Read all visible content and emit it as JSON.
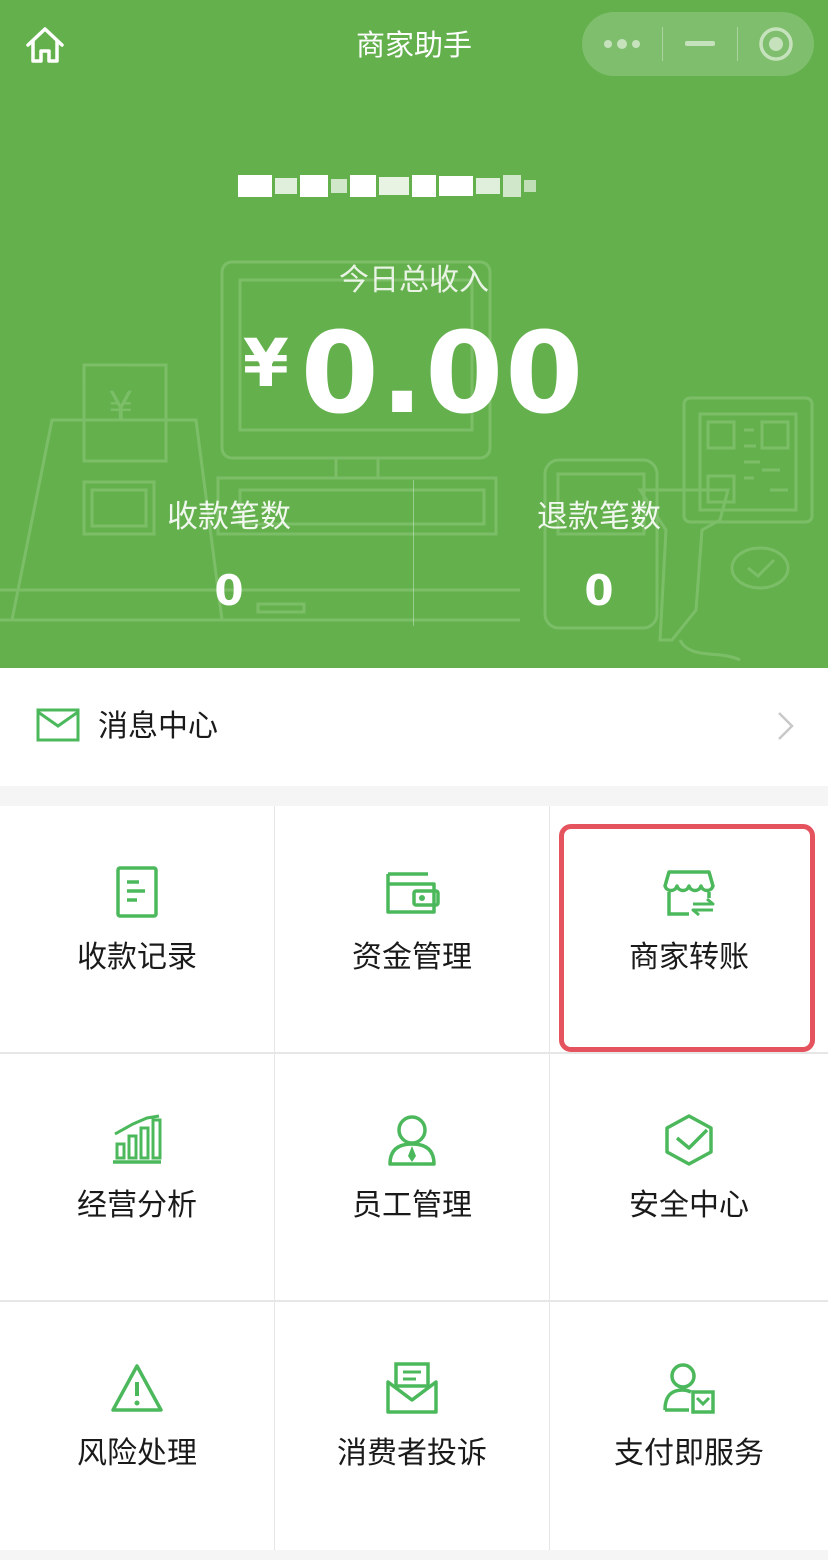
{
  "header": {
    "title": "商家助手",
    "merchant_name": "",
    "today_income_label": "今日总收入",
    "currency_symbol": "¥",
    "today_income_value": "0.00",
    "stats": [
      {
        "label": "收款笔数",
        "value": "0"
      },
      {
        "label": "退款笔数",
        "value": "0"
      }
    ],
    "background_color": "#63b04d"
  },
  "message_center": {
    "label": "消息中心"
  },
  "grid": {
    "items": [
      {
        "label": "收款记录",
        "icon": "receipt-icon"
      },
      {
        "label": "资金管理",
        "icon": "wallet-icon"
      },
      {
        "label": "商家转账",
        "icon": "store-transfer-icon",
        "highlighted": true
      },
      {
        "label": "经营分析",
        "icon": "bar-chart-icon"
      },
      {
        "label": "员工管理",
        "icon": "employee-icon"
      },
      {
        "label": "安全中心",
        "icon": "shield-icon"
      },
      {
        "label": "风险处理",
        "icon": "warning-icon"
      },
      {
        "label": "消费者投诉",
        "icon": "complaint-envelope-icon"
      },
      {
        "label": "支付即服务",
        "icon": "user-service-icon"
      }
    ]
  },
  "colors": {
    "accent_green": "#63b04d",
    "icon_green": "#4cb85c",
    "highlight_red": "#e5535f"
  }
}
